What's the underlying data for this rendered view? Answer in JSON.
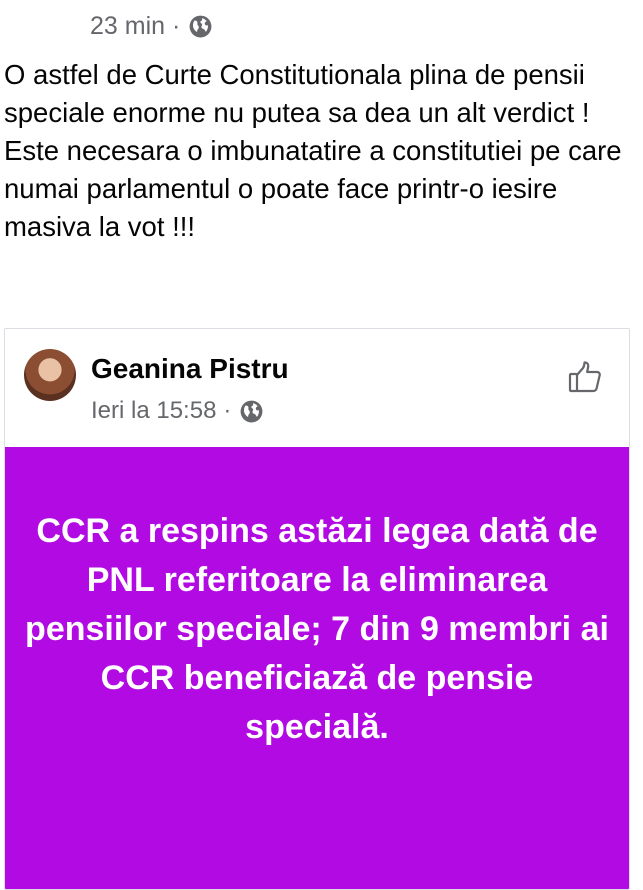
{
  "post": {
    "timestamp": "23 min",
    "separator": "·",
    "privacy_icon": "globe-icon",
    "text": "O astfel de Curte Constitutionala plina de pensii speciale enorme nu putea sa dea un alt verdict ! Este necesara o imbunatatire a constitutiei pe care numai parlamentul o poate face printr-o iesire masiva la vot !!!"
  },
  "shared_post": {
    "author": "Geanina Pistru",
    "timestamp": "Ieri la 15:58",
    "separator": "·",
    "privacy_icon": "globe-icon",
    "like_icon": "thumbs-up-icon",
    "banner_color": "#b20ae3",
    "banner_text": "CCR a respins astăzi legea dată de PNL referitoare la eliminarea pensiilor speciale; 7 din 9 membri ai CCR beneficiază de pensie specială."
  }
}
